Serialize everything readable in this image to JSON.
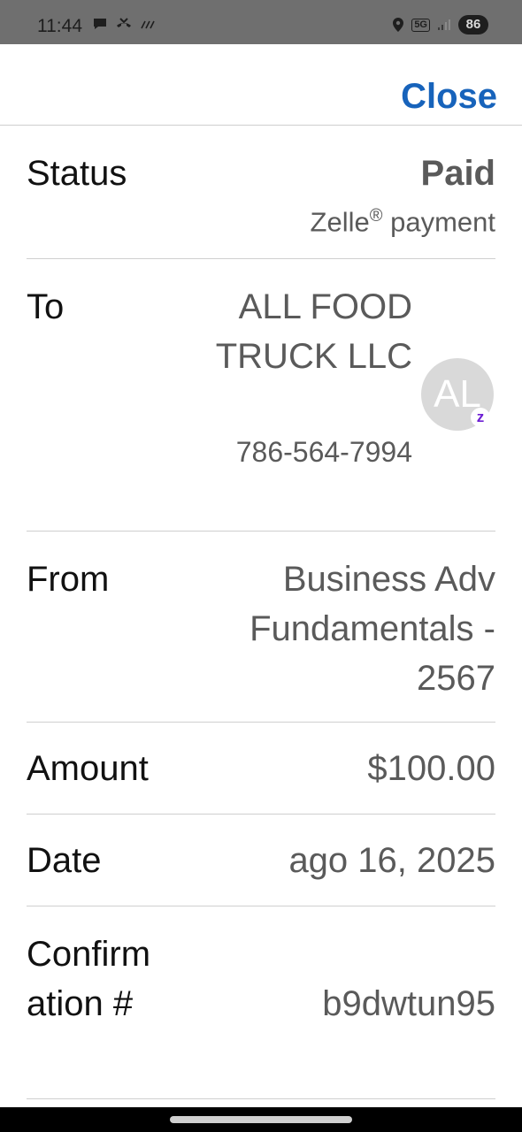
{
  "status_bar": {
    "time": "11:44",
    "network": "5G",
    "battery": "86"
  },
  "header": {
    "close_label": "Close"
  },
  "details": {
    "status": {
      "label": "Status",
      "value": "Paid",
      "method": "Zelle",
      "method_suffix": " payment"
    },
    "to": {
      "label": "To",
      "name": "ALL FOOD TRUCK LLC",
      "phone": "786-564-7994",
      "avatar_initials": "AL",
      "badge_letter": "z"
    },
    "from": {
      "label": "From",
      "value": "Business Adv Fundamentals - 2567"
    },
    "amount": {
      "label": "Amount",
      "value": "$100.00"
    },
    "date": {
      "label": "Date",
      "value": "ago 16, 2025"
    },
    "confirmation": {
      "label": "Confirmation #",
      "value": "b9dwtun95"
    }
  },
  "colors": {
    "accent": "#1763bb",
    "zelle_purple": "#6d1ed4",
    "divider": "#cfcfcf"
  }
}
